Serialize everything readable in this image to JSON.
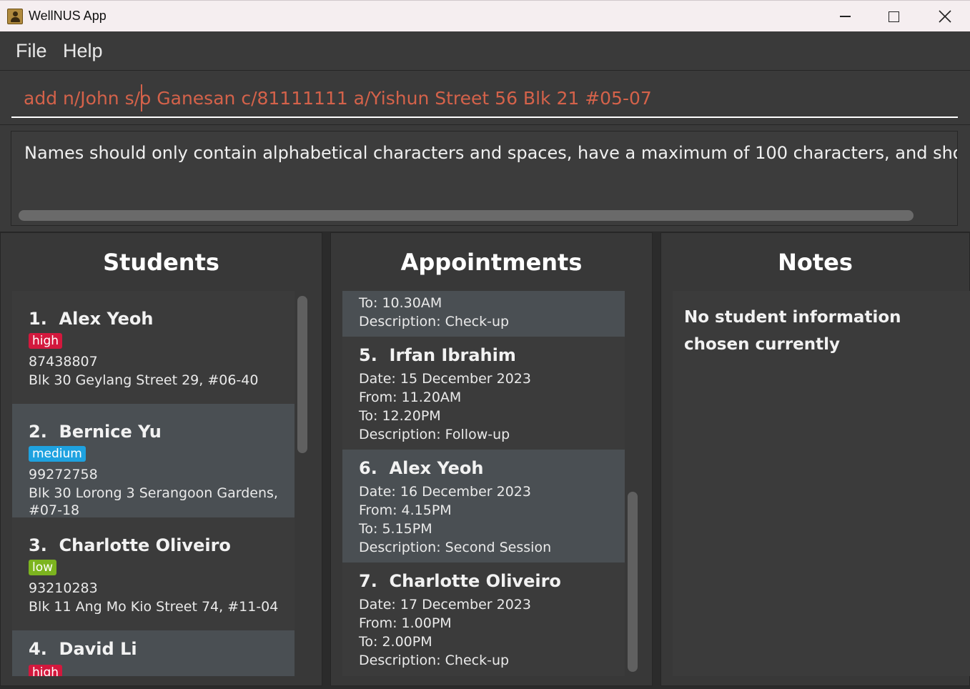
{
  "window": {
    "title": "WellNUS App"
  },
  "menu": {
    "file": "File",
    "help": "Help"
  },
  "command": {
    "value": "add n/John s/o Ganesan c/81111111 a/Yishun Street 56 Blk 21 #05-07"
  },
  "result": {
    "text": "Names should only contain alphabetical characters and spaces, have a maximum of 100 characters, and should not be bl"
  },
  "students": {
    "title": "Students",
    "items": [
      {
        "index": "1.",
        "name": "Alex Yeoh",
        "tag": "high",
        "phone": "87438807",
        "address": "Blk 30 Geylang Street 29, #06-40"
      },
      {
        "index": "2.",
        "name": "Bernice Yu",
        "tag": "medium",
        "phone": "99272758",
        "address": "Blk 30 Lorong 3 Serangoon Gardens,",
        "address2": "#07-18"
      },
      {
        "index": "3.",
        "name": "Charlotte Oliveiro",
        "tag": "low",
        "phone": "93210283",
        "address": "Blk 11 Ang Mo Kio Street 74, #11-04"
      },
      {
        "index": "4.",
        "name": "David Li",
        "tag": "high"
      }
    ]
  },
  "appointments": {
    "title": "Appointments",
    "partial": {
      "to": "To: 10.30AM",
      "description": "Description: Check-up"
    },
    "items": [
      {
        "index": "5.",
        "name": "Irfan Ibrahim",
        "date": "Date: 15 December 2023",
        "from": "From: 11.20AM",
        "to": "To: 12.20PM",
        "description": "Description: Follow-up"
      },
      {
        "index": "6.",
        "name": "Alex Yeoh",
        "date": "Date: 16 December 2023",
        "from": "From: 4.15PM",
        "to": "To: 5.15PM",
        "description": "Description: Second Session"
      },
      {
        "index": "7.",
        "name": "Charlotte Oliveiro",
        "date": "Date: 17 December 2023",
        "from": "From: 1.00PM",
        "to": "To: 2.00PM",
        "description": "Description: Check-up"
      }
    ]
  },
  "notes": {
    "title": "Notes",
    "text": "No student information chosen currently"
  },
  "colors": {
    "tag_high": "#d3183d",
    "tag_medium": "#1ea2e0",
    "tag_low": "#7cb41f",
    "command_text": "#d4624a"
  }
}
